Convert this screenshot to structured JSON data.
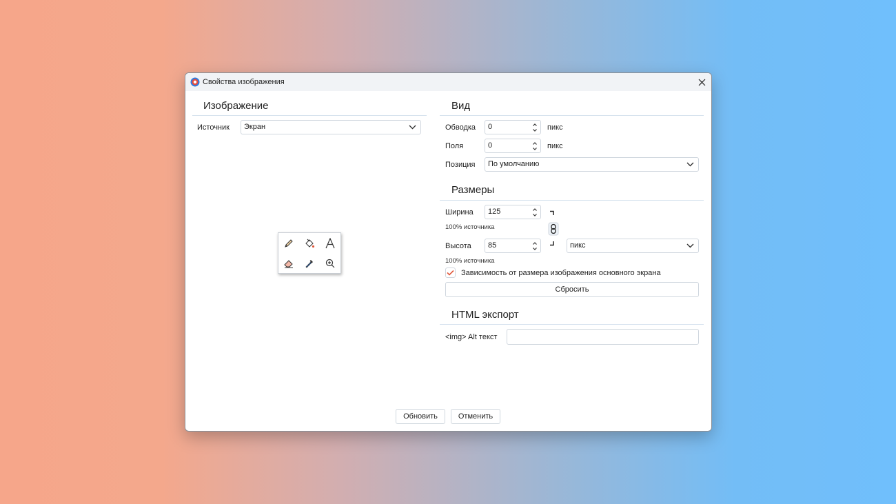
{
  "window": {
    "title": "Свойства изображения"
  },
  "image_section": {
    "heading": "Изображение",
    "source_label": "Источник",
    "source_value": "Экран"
  },
  "view_section": {
    "heading": "Вид",
    "border_label": "Обводка",
    "border_value": "0",
    "border_unit": "пикс",
    "padding_label": "Поля",
    "padding_value": "0",
    "padding_unit": "пикс",
    "position_label": "Позиция",
    "position_value": "По умолчанию"
  },
  "size_section": {
    "heading": "Размеры",
    "width_label": "Ширина",
    "width_value": "125",
    "width_hint": "100% источника",
    "height_label": "Высота",
    "height_value": "85",
    "height_hint": "100% источника",
    "unit_value": "пикс",
    "depend_label": "Зависимость от размера изображения основного экрана",
    "depend_checked": true,
    "reset_label": "Сбросить"
  },
  "html_section": {
    "heading": "HTML экспорт",
    "alt_label": "<img> Alt текст",
    "alt_value": ""
  },
  "footer": {
    "update_label": "Обновить",
    "cancel_label": "Отменить"
  },
  "toolbox": {
    "tools": [
      "pencil-icon",
      "fill-bucket-icon",
      "text-icon",
      "eraser-icon",
      "color-picker-icon",
      "zoom-icon"
    ]
  },
  "colors": {
    "accent": "#e0573a",
    "separator": "#d6e2ee",
    "border": "#cfd6de"
  }
}
